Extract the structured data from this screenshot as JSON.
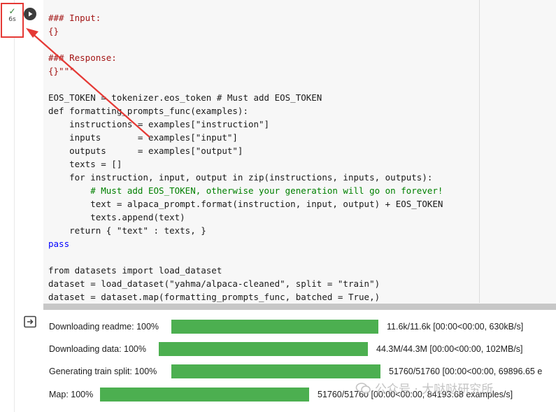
{
  "status": {
    "check": "✓",
    "time": "6s"
  },
  "run_button": {
    "icon": "play-icon"
  },
  "code_lines": [
    "### Input:",
    "{}",
    "",
    "### Response:",
    "{}\"\"\"",
    "",
    "EOS_TOKEN = tokenizer.eos_token # Must add EOS_TOKEN",
    "def formatting_prompts_func(examples):",
    "    instructions = examples[\"instruction\"]",
    "    inputs       = examples[\"input\"]",
    "    outputs      = examples[\"output\"]",
    "    texts = []",
    "    for instruction, input, output in zip(instructions, inputs, outputs):",
    "        # Must add EOS_TOKEN, otherwise your generation will go on forever!",
    "        text = alpaca_prompt.format(instruction, input, output) + EOS_TOKEN",
    "        texts.append(text)",
    "    return { \"text\" : texts, }",
    "pass",
    "",
    "from datasets import load_dataset",
    "dataset = load_dataset(\"yahma/alpaca-cleaned\", split = \"train\")",
    "dataset = dataset.map(formatting_prompts_func, batched = True,)"
  ],
  "output": {
    "rows": [
      {
        "label": "Downloading readme: 100%",
        "progress": 1.0,
        "stats": "11.6k/11.6k [00:00<00:00, 630kB/s]"
      },
      {
        "label": "Downloading data: 100%",
        "progress": 1.0,
        "stats": "44.3M/44.3M [00:00<00:00, 102MB/s]"
      },
      {
        "label": "Generating train split: 100%",
        "progress": 1.0,
        "stats": "51760/51760 [00:00<00:00, 69896.65 e"
      },
      {
        "label": "Map: 100%",
        "progress": 1.0,
        "stats": "51760/51760 [00:00<00:00, 84193.68 examples/s]"
      }
    ]
  },
  "watermark": "公众号 · 大哒哒研究所",
  "colors": {
    "progress": "#4caf50",
    "highlight": "#e53935"
  }
}
